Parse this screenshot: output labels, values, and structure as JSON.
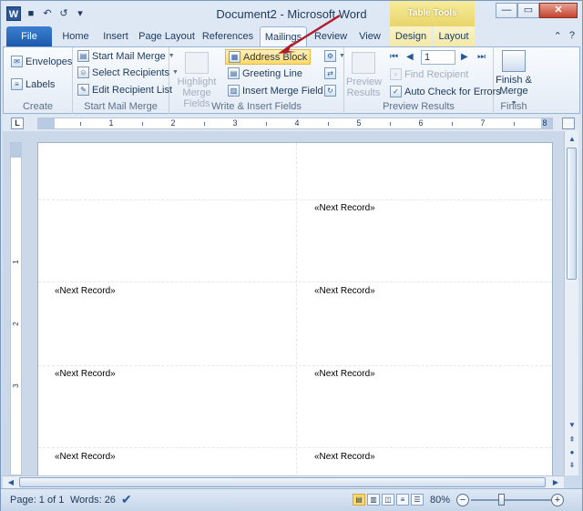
{
  "window": {
    "title": "Document2 - Microsoft Word",
    "contextual_tab_group": "Table Tools",
    "controls": {
      "minimize": "—",
      "maximize": "▭",
      "close": "✕"
    }
  },
  "qat": {
    "word_icon": "W",
    "save": "💾",
    "undo": "↶",
    "redo": "↺",
    "customize": "▾"
  },
  "tabs": [
    "File",
    "Home",
    "Insert",
    "Page Layout",
    "References",
    "Mailings",
    "Review",
    "View",
    "Design",
    "Layout"
  ],
  "active_tab": "Mailings",
  "ribbon": {
    "create": {
      "label": "Create",
      "envelopes": "Envelopes",
      "labels": "Labels"
    },
    "start_mail_merge": {
      "label": "Start Mail Merge",
      "start": "Start Mail Merge",
      "select_recipients": "Select Recipients",
      "edit_list": "Edit Recipient List"
    },
    "write_insert": {
      "label": "Write & Insert Fields",
      "highlight_1": "Highlight",
      "highlight_2": "Merge Fields",
      "address_block": "Address Block",
      "greeting_line": "Greeting Line",
      "insert_merge_field": "Insert Merge Field"
    },
    "preview": {
      "label": "Preview Results",
      "preview_1": "Preview",
      "preview_2": "Results",
      "record_value": "1",
      "find_recipient": "Find Recipient",
      "auto_check": "Auto Check for Errors"
    },
    "finish": {
      "label": "Finish",
      "finish_1": "Finish &",
      "finish_2": "Merge"
    }
  },
  "ruler": {
    "corner": "L",
    "numbers": [
      "1",
      "2",
      "3",
      "4",
      "5",
      "6",
      "7",
      "8"
    ],
    "vertical_numbers": [
      "1",
      "2",
      "3"
    ]
  },
  "document": {
    "field_text": "«Next Record»"
  },
  "status": {
    "page": "Page: 1 of 1",
    "words": "Words: 26",
    "zoom": "80%",
    "zoom_out": "−",
    "zoom_in": "+"
  },
  "colors": {
    "file_tab": "#2b5797",
    "highlight": "#ffd96a",
    "arrow": "#b01c2a",
    "contextual": "#e8d56a"
  }
}
